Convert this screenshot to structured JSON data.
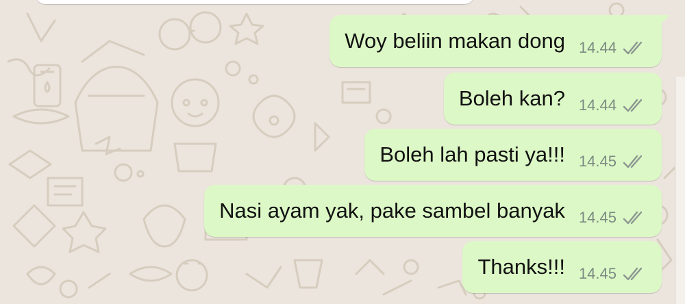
{
  "chat": {
    "messages": [
      {
        "text": "Woy beliin makan dong",
        "time": "14.44",
        "status": "read-double-check-icon"
      },
      {
        "text": "Boleh kan?",
        "time": "14.44",
        "status": "read-double-check-icon"
      },
      {
        "text": "Boleh lah pasti ya!!!",
        "time": "14.45",
        "status": "read-double-check-icon"
      },
      {
        "text": "Nasi ayam yak, pake sambel banyak",
        "time": "14.45",
        "status": "read-double-check-icon"
      },
      {
        "text": "Thanks!!!",
        "time": "14.45",
        "status": "read-double-check-icon"
      }
    ]
  },
  "colors": {
    "background": "#ece5dd",
    "outgoing_bubble": "#dcf8c6",
    "text": "#111111",
    "timestamp": "#7c8a82"
  }
}
